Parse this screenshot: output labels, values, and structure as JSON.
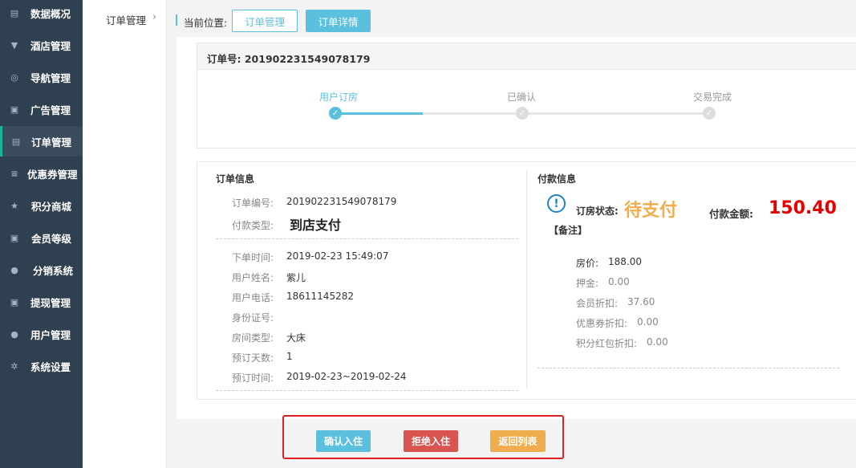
{
  "sidebar": {
    "items": [
      {
        "label": "数据概况",
        "icon": "dashboard-icon",
        "glyph": "▤"
      },
      {
        "label": "酒店管理",
        "icon": "cart-icon",
        "glyph": "▼"
      },
      {
        "label": "导航管理",
        "icon": "compass-icon",
        "glyph": "◎"
      },
      {
        "label": "广告管理",
        "icon": "gift-icon",
        "glyph": "▣"
      },
      {
        "label": "订单管理",
        "icon": "order-list-icon",
        "glyph": "▤",
        "active": true
      },
      {
        "label": "优惠券管理",
        "icon": "menu-lines-icon",
        "glyph": "≡"
      },
      {
        "label": "积分商城",
        "icon": "star-icon",
        "glyph": "★"
      },
      {
        "label": "会员等级",
        "icon": "money-icon",
        "glyph": "▣"
      },
      {
        "label": "分销系统",
        "icon": "users-icon",
        "glyph": "●"
      },
      {
        "label": "提现管理",
        "icon": "cash-icon",
        "glyph": "▣"
      },
      {
        "label": "用户管理",
        "icon": "user-icon",
        "glyph": "●"
      },
      {
        "label": "系统设置",
        "icon": "gear-icon",
        "glyph": "✲"
      }
    ]
  },
  "subnav": {
    "label": "订单管理",
    "arrow": "›"
  },
  "breadcrumb": {
    "label": "当前位置:",
    "crumb1": "订单管理",
    "crumb2": "订单详情"
  },
  "order": {
    "header": "订单号: 201902231549078179"
  },
  "steps": [
    {
      "label": "用户订房",
      "done": true
    },
    {
      "label": "已确认",
      "done": false
    },
    {
      "label": "交易完成",
      "done": false
    }
  ],
  "order_info": {
    "title": "订单信息",
    "number_label": "订单编号:",
    "number": "201902231549078179",
    "paytype_label": "付款类型:",
    "paytype": "到店支付",
    "rows": [
      {
        "label": "下单时间:",
        "value": "2019-02-23 15:49:07"
      },
      {
        "label": "用户姓名:",
        "value": "紫儿"
      },
      {
        "label": "用户电话:",
        "value": "18611145282"
      },
      {
        "label": "身份证号:",
        "value": ""
      },
      {
        "label": "房间类型:",
        "value": "大床"
      },
      {
        "label": "预订天数:",
        "value": "1"
      },
      {
        "label": "预订时间:",
        "value": "2019-02-23~2019-02-24"
      }
    ]
  },
  "payment": {
    "title": "付款信息",
    "status_label": "订房状态:",
    "status": "待支付",
    "amount_label": "付款金额:",
    "amount": "150.40",
    "note": "【备注】",
    "rows": [
      {
        "label": "房价:",
        "value": "188.00"
      },
      {
        "label": "押金:",
        "value": "0.00"
      },
      {
        "label": "会员折扣:",
        "value": "37.60"
      },
      {
        "label": "优惠券折扣:",
        "value": "0.00"
      },
      {
        "label": "积分红包折扣:",
        "value": "0.00"
      }
    ]
  },
  "actions": {
    "confirm": "确认入住",
    "reject": "拒绝入住",
    "back": "返回列表"
  },
  "colors": {
    "sidebar": "#2f4050",
    "accent": "#5bc0de",
    "progress": "#5bc0de",
    "status": "#f0ad4e",
    "amount": "#e60000",
    "confirm": "#5bc0de",
    "reject": "#d9534f",
    "back": "#f0ad4e"
  }
}
